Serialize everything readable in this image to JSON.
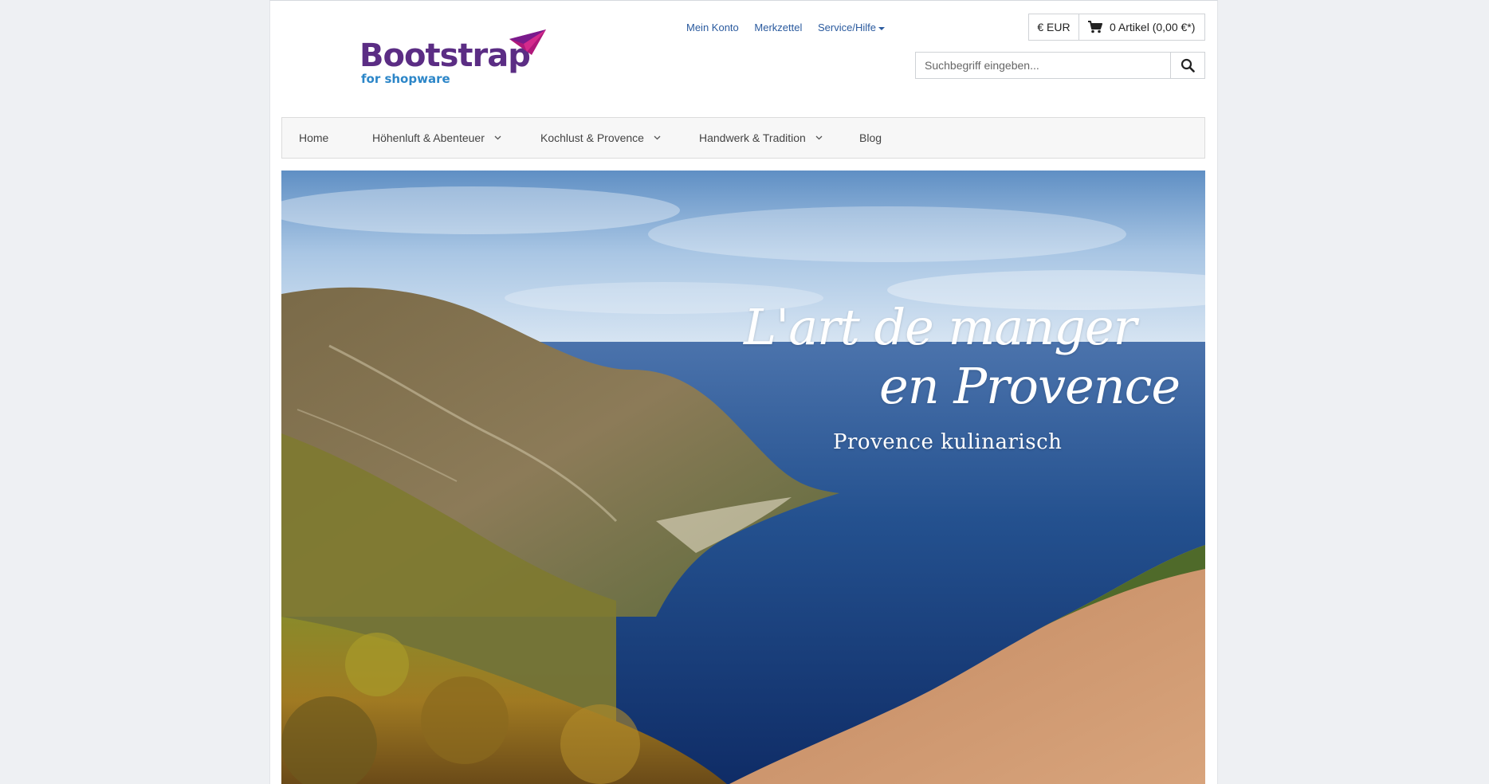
{
  "logo": {
    "title": "Bootstrap",
    "subtitle": "for shopware"
  },
  "top_links": {
    "account": "Mein Konto",
    "wishlist": "Merkzettel",
    "service": "Service/Hilfe"
  },
  "currency": {
    "label": "€ EUR"
  },
  "cart": {
    "label": "0 Artikel (0,00 €*)"
  },
  "search": {
    "placeholder": "Suchbegriff eingeben..."
  },
  "nav": {
    "items": [
      {
        "label": "Home",
        "has_dropdown": false
      },
      {
        "label": "Höhenluft & Abenteuer",
        "has_dropdown": true
      },
      {
        "label": "Kochlust & Provence",
        "has_dropdown": true
      },
      {
        "label": "Handwerk & Tradition",
        "has_dropdown": true
      },
      {
        "label": "Blog",
        "has_dropdown": false
      }
    ]
  },
  "hero": {
    "line1": "L'art de manger",
    "line2": "en Provence",
    "subtitle": "Provence kulinarisch"
  },
  "colors": {
    "brand_purple": "#5b2d84",
    "brand_blue": "#2c86c8",
    "link_blue": "#2a5a9e",
    "plane_magenta": "#b0187a"
  }
}
